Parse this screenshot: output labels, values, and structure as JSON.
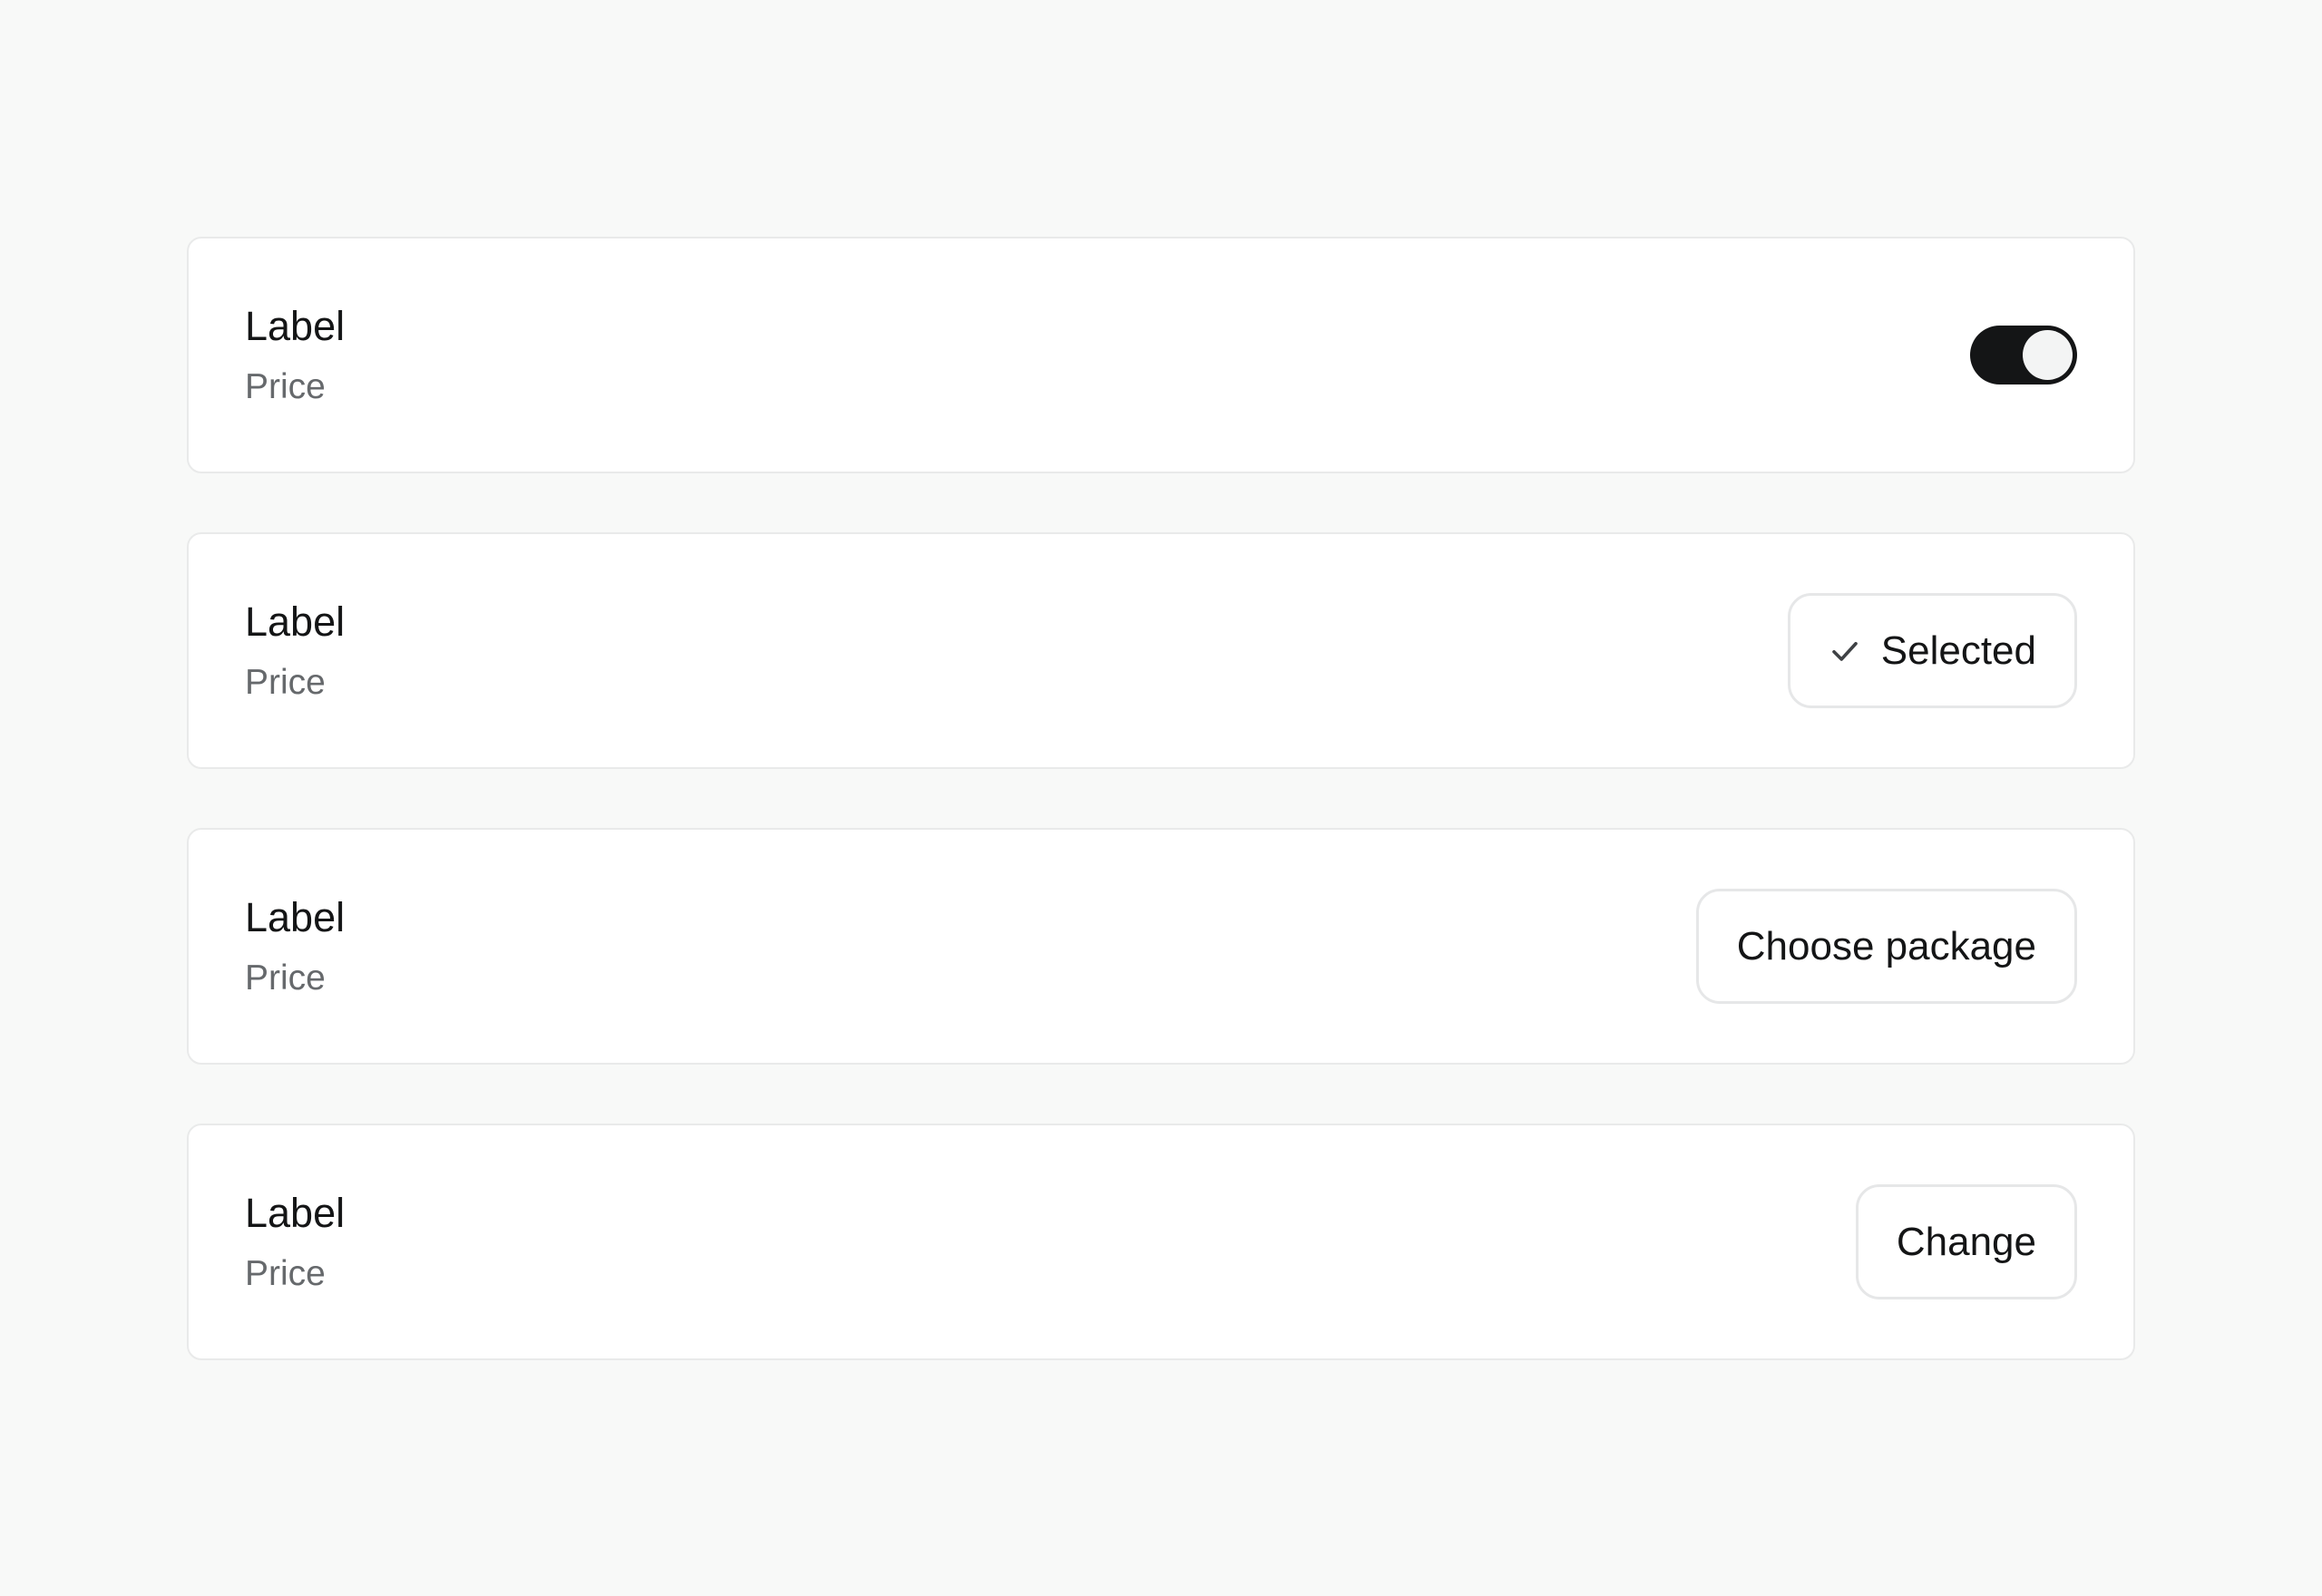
{
  "rows": [
    {
      "label": "Label",
      "price": "Price",
      "control": "toggle",
      "toggle_on": true
    },
    {
      "label": "Label",
      "price": "Price",
      "control": "button",
      "button_label": "Selected",
      "icon": "check-icon"
    },
    {
      "label": "Label",
      "price": "Price",
      "control": "button",
      "button_label": "Choose package"
    },
    {
      "label": "Label",
      "price": "Price",
      "control": "button",
      "button_label": "Change"
    }
  ],
  "colors": {
    "background": "#f8f9f8",
    "card": "#ffffff",
    "border": "#e9eaea",
    "text_primary": "#141516",
    "text_secondary": "#66696c",
    "toggle_on": "#141516"
  }
}
